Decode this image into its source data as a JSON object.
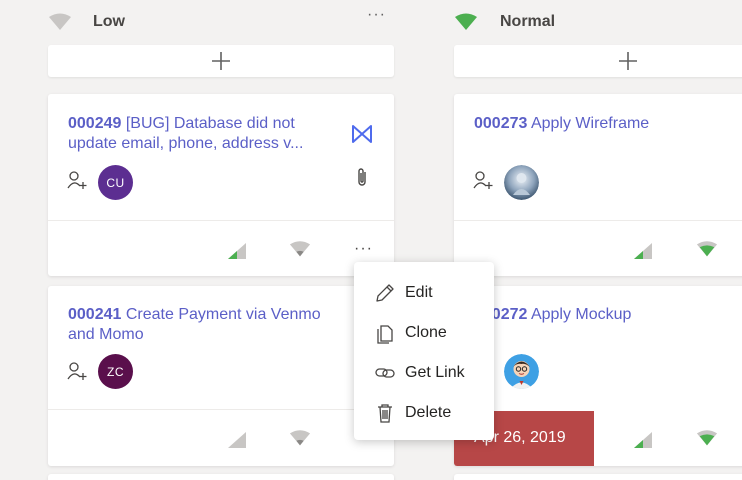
{
  "colors": {
    "accent": "#5b5fc7",
    "green": "#4caf50",
    "gray_icon": "#c8c6c4",
    "date_overdue": "#b74747",
    "avatar_cu": "#5c2e91",
    "avatar_zc": "#5a0f4c"
  },
  "columns": [
    {
      "title": "Low",
      "priority_icon": "low-priority-icon",
      "more_label": "···",
      "add_icon": "plus-icon",
      "cards": [
        {
          "id": "000249",
          "title": "[BUG] Database did not update email, phone, address v...",
          "assignee_initials": "CU",
          "card_icons": [
            "devops-icon",
            "paperclip-icon"
          ],
          "more_label": "···"
        },
        {
          "id": "000241",
          "title": "Create Payment via Venmo and Momo",
          "assignee_initials": "ZC",
          "card_icons": [
            "devops-icon"
          ]
        }
      ]
    },
    {
      "title": "Normal",
      "priority_icon": "normal-priority-icon",
      "add_icon": "plus-icon",
      "cards": [
        {
          "id": "000273",
          "title": "Apply Wireframe",
          "assignee": "photo-avatar"
        },
        {
          "id": "000272",
          "title": "Apply Mockup",
          "assignee": "cartoon-avatar",
          "due_date": "Apr 26, 2019"
        }
      ]
    }
  ],
  "context_menu": {
    "items": [
      {
        "label": "Edit",
        "icon": "pencil-icon"
      },
      {
        "label": "Clone",
        "icon": "copy-icon"
      },
      {
        "label": "Get Link",
        "icon": "link-icon"
      },
      {
        "label": "Delete",
        "icon": "trash-icon"
      }
    ]
  }
}
